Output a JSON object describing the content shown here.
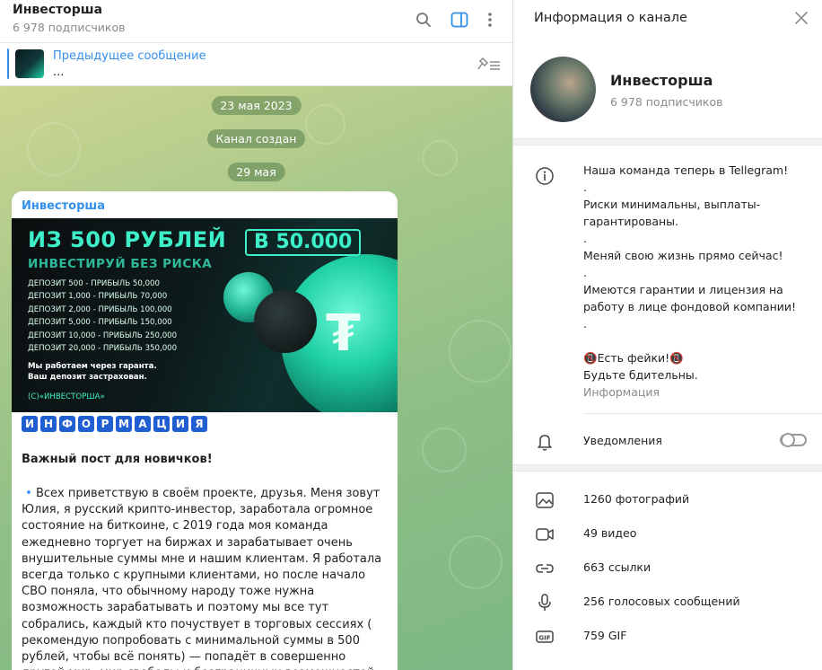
{
  "chat": {
    "title": "Инвесторша",
    "subscribers": "6 978 подписчиков",
    "pinned": {
      "title": "Предыдущее сообщение",
      "text": "..."
    },
    "date1": "23 мая 2023",
    "service": "Канал создан",
    "date2": "29 мая",
    "message": {
      "author": "Инвесторша",
      "banner": {
        "headline": "ИЗ 500 РУБЛЕЙ",
        "headline_box": "В 50.000",
        "subheadline": "ИНВЕСТИРУЙ БЕЗ РИСКА",
        "rows": [
          "ДЕПОЗИТ 500 - ПРИБЫЛЬ 50,000",
          "ДЕПОЗИТ 1,000 - ПРИБЫЛЬ 70,000",
          "ДЕПОЗИТ 2,000 - ПРИБЫЛЬ 100,000",
          "ДЕПОЗИТ 5,000 - ПРИБЫЛЬ 150,000",
          "ДЕПОЗИТ 10,000 - ПРИБЫЛЬ 250,000",
          "ДЕПОЗИТ 20,000 - ПРИБЫЛЬ 350,000"
        ],
        "note1": "Мы работаем через гаранта.",
        "note2": "Ваш депозит застрахован.",
        "tag": "(С)«ИНВЕСТОРША»"
      },
      "emoji_letters": [
        "И",
        "Н",
        "Ф",
        "О",
        "Р",
        "М",
        "А",
        "Ц",
        "И",
        "Я"
      ],
      "heading": "Важный пост для новичков!",
      "body": "Всех приветствую в своём проекте, друзья. Меня зовут Юлия, я русский крипто-инвестор, заработала огромное состояние на биткоине, с 2019 года моя команда ежедневно торгует на биржах и зарабатывает очень внушительные суммы мне и нашим клиентам. Я работала всегда только с крупными клиентами, но после начало СВО поняла, что обычному народу тоже нужна возможность зарабатывать и поэтому мы все тут собрались, каждый кто почуствует в торговых сессиях ( рекомендую попробовать с минимальной суммы в 500 рублей, чтобы всё понять) — попадёт в совершенно другой мир, мир свободы и безграничных возможностей."
    }
  },
  "info": {
    "title": "Информация о канале",
    "name": "Инвесторша",
    "subscribers": "6 978 подписчиков",
    "about": [
      "Наша команда теперь в Tellegram!",
      ".",
      "Риски минимальны, выплаты-гарантированы.",
      ".",
      "Меняй свою жизнь прямо сейчас!",
      ".",
      "Имеются гарантии и лицензия на работу в лице фондовой компании!",
      ".",
      "",
      "📵Есть фейки!📵",
      "Будьте бдительны."
    ],
    "about_label": "Информация",
    "notifications": "Уведомления",
    "notifications_on": false,
    "media": [
      {
        "icon": "photo-icon",
        "label": "1260 фотографий"
      },
      {
        "icon": "video-icon",
        "label": "49 видео"
      },
      {
        "icon": "link-icon",
        "label": "663 ссылки"
      },
      {
        "icon": "microphone-icon",
        "label": "256 голосовых сообщений"
      },
      {
        "icon": "gif-icon",
        "label": "759 GIF"
      }
    ]
  },
  "colors": {
    "accent": "#3390ec",
    "letter_box": "#1f5fd1",
    "banner_mint": "#3ef0c9"
  }
}
